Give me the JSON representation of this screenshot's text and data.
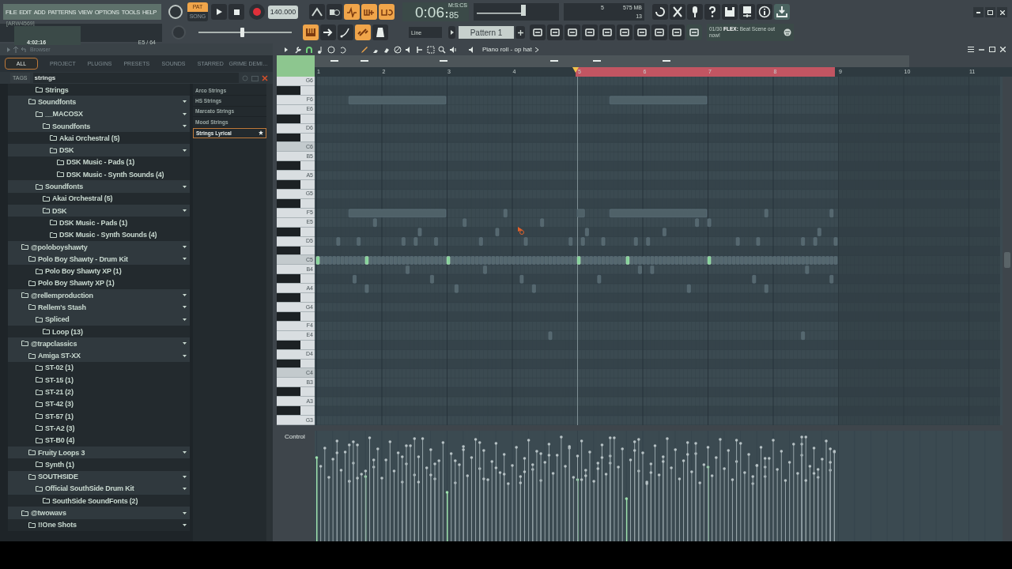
{
  "menu": [
    "FILE",
    "EDIT",
    "ADD",
    "PATTERNS",
    "VIEW",
    "OPTIONS",
    "TOOLS",
    "HELP"
  ],
  "hint_panel": {
    "title": "[ARW4569]",
    "time": "4:02:16",
    "polyphony": "E5 / 64"
  },
  "mode": [
    {
      "label": "PAT",
      "selected": true
    },
    {
      "label": "SONG",
      "selected": false
    }
  ],
  "tempo": "140.000",
  "pitch_slider": {
    "level": 0.47
  },
  "toggles_top": [
    {
      "on": false
    },
    {
      "on": false
    },
    {
      "on": true
    },
    {
      "on": true
    },
    {
      "on": true
    }
  ],
  "toggles_bottom": [
    {
      "on": true
    },
    {
      "on": false
    },
    {
      "on": false
    },
    {
      "on": true
    },
    {
      "on": false
    }
  ],
  "time": {
    "main": "0:06",
    "centis": "85",
    "unit": "M:S:CS"
  },
  "cpu": {
    "voices": "5",
    "memory": "575 MB",
    "count": "13"
  },
  "snap": "Line",
  "pattern": "Pattern 1",
  "news": {
    "count": "01/30",
    "text": "**FLEX:** Beat Scene out now!"
  },
  "browser": {
    "title": "Browser",
    "tabs": [
      {
        "label": "ALL",
        "selected": true
      },
      {
        "label": "PROJECT",
        "selected": false
      },
      {
        "label": "PLUGINS",
        "selected": false
      },
      {
        "label": "PRESETS",
        "selected": false
      },
      {
        "label": "SOUNDS",
        "selected": false
      },
      {
        "label": "STARRED",
        "selected": false
      },
      {
        "label": "GRIME DEMI…",
        "selected": false
      }
    ],
    "tags_label": "TAGS",
    "search": "strings",
    "tree": [
      {
        "children": [
          {
            "children": [
              {
                "label": "Strings",
                "expanded": false
              }
            ]
          },
          {
            "label": "Soundfonts",
            "expanded": true,
            "children": [
              {
                "label": "__MACOSX",
                "expanded": true,
                "children": [
                  {
                    "label": "Soundfonts",
                    "expanded": true,
                    "children": [
                      {
                        "label": "Akai Orchestral (5)",
                        "expanded": false
                      },
                      {
                        "label": "DSK",
                        "expanded": true,
                        "children": [
                          {
                            "label": "DSK Music - Pads (1)",
                            "expanded": false
                          },
                          {
                            "label": "DSK Music - Synth Sounds (4)",
                            "expanded": false
                          }
                        ]
                      }
                    ]
                  }
                ]
              },
              {
                "label": "Soundfonts",
                "expanded": true,
                "children": [
                  {
                    "label": "Akai Orchestral (5)",
                    "expanded": false
                  },
                  {
                    "label": "DSK",
                    "expanded": true,
                    "children": [
                      {
                        "label": "DSK Music - Pads (1)",
                        "expanded": false
                      },
                      {
                        "label": "DSK Music - Synth Sounds (4)",
                        "expanded": false
                      }
                    ]
                  }
                ]
              }
            ]
          }
        ]
      },
      {
        "label": "@poloboyshawty",
        "expanded": true,
        "children": [
          {
            "label": "Polo Boy Shawty - Drum Kit",
            "expanded": true,
            "children": [
              {
                "label": "Polo Boy Shawty XP (1)",
                "expanded": false
              }
            ]
          },
          {
            "label": "Polo Boy Shawty XP (1)",
            "expanded": false
          }
        ]
      },
      {
        "label": "@rellemproduction",
        "expanded": true,
        "children": [
          {
            "label": "Rellem's Stash",
            "expanded": true,
            "children": [
              {
                "label": "Spliced",
                "expanded": true,
                "children": [
                  {
                    "label": "Loop (13)",
                    "expanded": false
                  }
                ]
              }
            ]
          }
        ]
      },
      {
        "label": "@trapclassics",
        "expanded": true,
        "children": [
          {
            "label": "Amiga ST-XX",
            "expanded": true,
            "children": [
              {
                "label": "ST-02 (1)",
                "expanded": false
              },
              {
                "label": "ST-15 (1)",
                "expanded": false
              },
              {
                "label": "ST-21 (2)",
                "expanded": false
              },
              {
                "label": "ST-42 (3)",
                "expanded": false
              },
              {
                "label": "ST-57 (1)",
                "expanded": false
              },
              {
                "label": "ST-A2 (3)",
                "expanded": false
              },
              {
                "label": "ST-B0 (4)",
                "expanded": false
              }
            ]
          },
          {
            "label": "Fruity Loops 3",
            "expanded": true,
            "children": [
              {
                "label": "Synth (1)",
                "expanded": false
              }
            ]
          },
          {
            "label": "SOUTHSIDE",
            "expanded": true,
            "children": [
              {
                "label": "Official SouthSide Drum Kit",
                "expanded": true,
                "children": [
                  {
                    "label": "SouthSide SoundFonts (2)",
                    "expanded": false
                  }
                ]
              }
            ]
          }
        ]
      },
      {
        "label": "@twowavs",
        "expanded": true,
        "children": [
          {
            "label": "!!One Shots",
            "expanded": true
          }
        ]
      }
    ],
    "results": [
      {
        "label": "Arco Strings",
        "selected": false
      },
      {
        "label": "HS Strings",
        "selected": false
      },
      {
        "label": "Marcato Strings",
        "selected": false
      },
      {
        "label": "Mood Strings",
        "selected": false
      },
      {
        "label": "Strings Lyrical",
        "selected": true
      }
    ]
  },
  "piano_roll": {
    "title": "Piano roll - op hat",
    "bar_numbers": [
      "1",
      "2",
      "3",
      "4",
      "5",
      "6",
      "7",
      "8",
      "9",
      "10",
      "11"
    ],
    "key_labels": [
      "G6",
      "F6",
      "E6",
      "D6",
      "C6",
      "B5",
      "A5",
      "G5",
      "F5",
      "E5",
      "D5",
      "C5",
      "B4",
      "A4",
      "G4",
      "F4",
      "E4",
      "D4",
      "C4",
      "B3",
      "A3",
      "G3"
    ],
    "control_label": "Control"
  }
}
